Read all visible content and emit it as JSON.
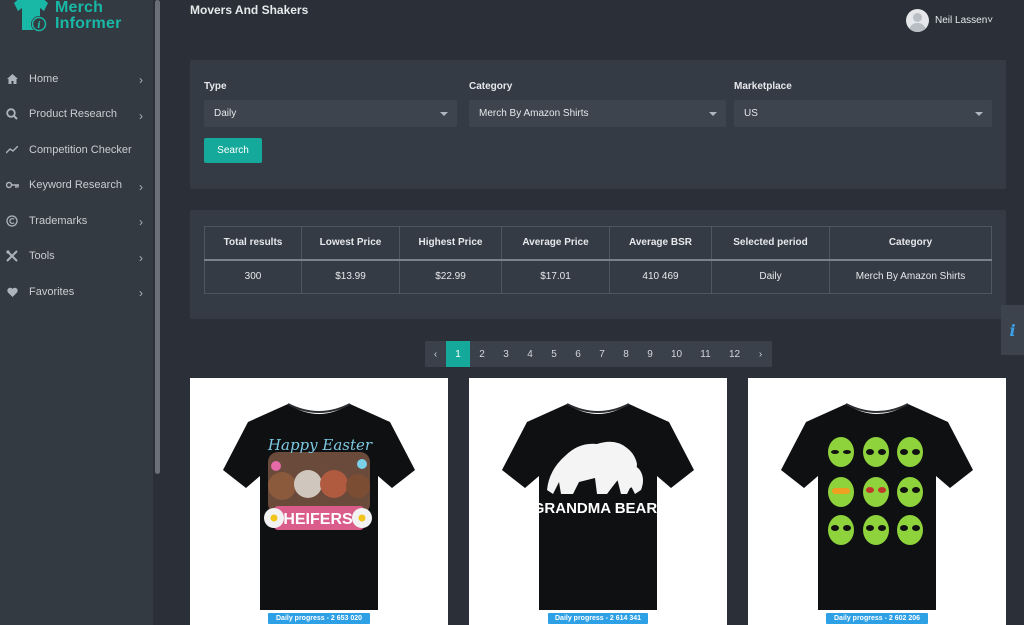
{
  "brand": {
    "line1": "Merch",
    "line2": "Informer"
  },
  "sidebar": {
    "items": [
      {
        "label": "Home",
        "icon": "home-icon",
        "chevron": true
      },
      {
        "label": "Product Research",
        "icon": "search-icon",
        "chevron": true
      },
      {
        "label": "Competition Checker",
        "icon": "trend-icon",
        "chevron": false
      },
      {
        "label": "Keyword Research",
        "icon": "key-icon",
        "chevron": true
      },
      {
        "label": "Trademarks",
        "icon": "copyright-icon",
        "chevron": true
      },
      {
        "label": "Tools",
        "icon": "tools-icon",
        "chevron": true
      },
      {
        "label": "Favorites",
        "icon": "heart-icon",
        "chevron": true
      }
    ]
  },
  "header": {
    "title": "Movers And Shakers",
    "user_name": "Neil Lassen",
    "user_caret": "˅"
  },
  "filters": {
    "type": {
      "label": "Type",
      "value": "Daily"
    },
    "category": {
      "label": "Category",
      "value": "Merch By Amazon Shirts"
    },
    "marketplace": {
      "label": "Marketplace",
      "value": "US"
    },
    "search_label": "Search"
  },
  "stats": {
    "headers": [
      "Total results",
      "Lowest Price",
      "Highest Price",
      "Average Price",
      "Average BSR",
      "Selected period",
      "Category"
    ],
    "values": [
      "300",
      "$13.99",
      "$22.99",
      "$17.01",
      "410 469",
      "Daily",
      "Merch By Amazon Shirts"
    ]
  },
  "pagination": {
    "prev": "‹",
    "pages": [
      "1",
      "2",
      "3",
      "4",
      "5",
      "6",
      "7",
      "8",
      "9",
      "10",
      "11",
      "12"
    ],
    "next": "›",
    "active": "1"
  },
  "products": [
    {
      "design_text": [
        "Happy Easter",
        "HEIFERS"
      ],
      "badge": "Daily progress - 2 653 020"
    },
    {
      "design_text": [
        "GRANDMA BEAR"
      ],
      "badge": "Daily progress - 2 614 341"
    },
    {
      "design_text": [],
      "badge": "Daily progress - 2 602 206"
    }
  ],
  "info_tab": "i",
  "colors": {
    "accent": "#14a99a",
    "badge": "#2ea0e6",
    "background": "#2b3038",
    "panel": "#343b45"
  }
}
